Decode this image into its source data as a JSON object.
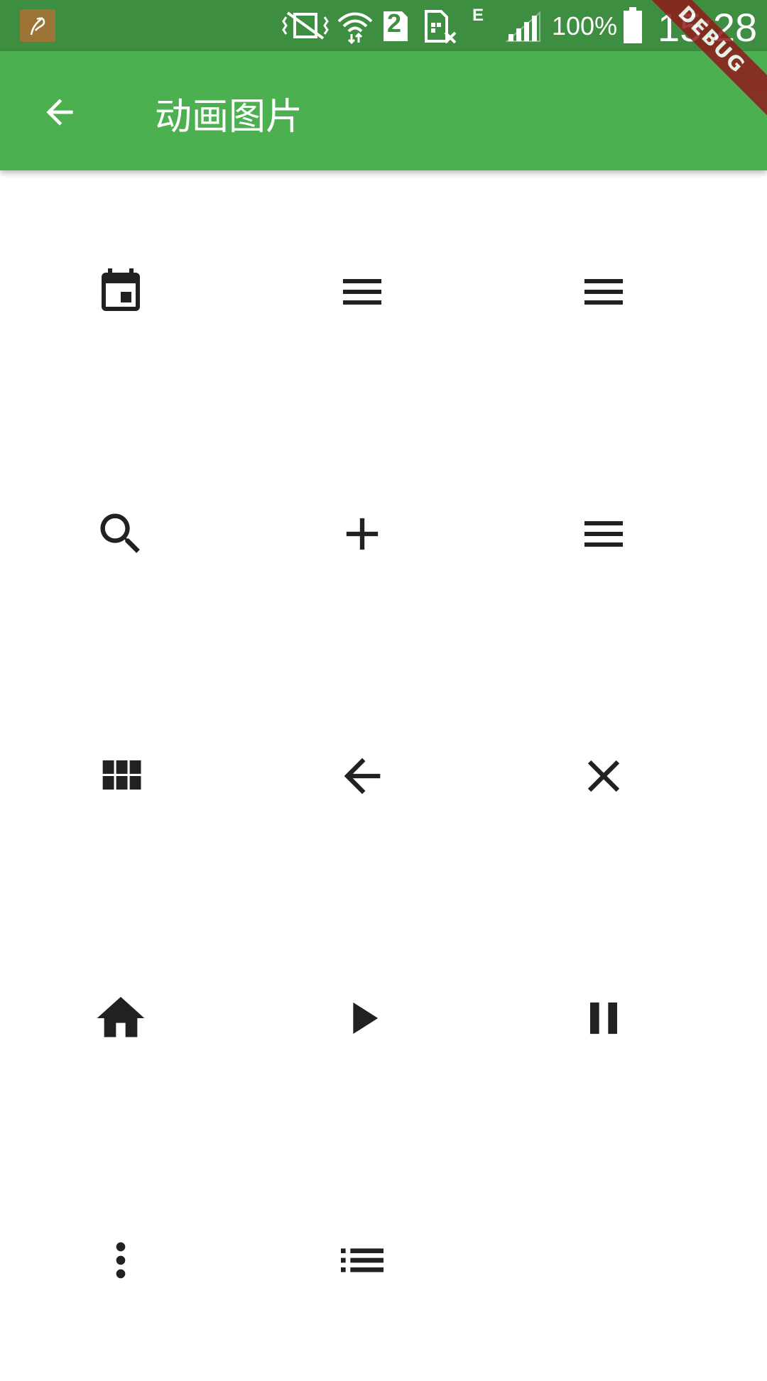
{
  "status_bar": {
    "network_type": "E",
    "sim_slot": "2",
    "battery_percent": "100%",
    "time": "15:28"
  },
  "debug_banner": "DEBUG",
  "app_bar": {
    "title": "动画图片",
    "back_icon": "arrow-back-icon",
    "background_color": "#4caf50"
  },
  "icons": [
    {
      "name": "calendar-icon"
    },
    {
      "name": "menu-icon"
    },
    {
      "name": "menu-icon"
    },
    {
      "name": "search-icon"
    },
    {
      "name": "add-icon"
    },
    {
      "name": "menu-icon"
    },
    {
      "name": "grid-view-icon"
    },
    {
      "name": "arrow-back-icon"
    },
    {
      "name": "close-icon"
    },
    {
      "name": "home-icon"
    },
    {
      "name": "play-icon"
    },
    {
      "name": "pause-icon"
    },
    {
      "name": "more-vert-icon"
    },
    {
      "name": "list-icon"
    }
  ],
  "colors": {
    "status_bar": "#3e8e41",
    "app_bar": "#4caf50",
    "icon": "#212121"
  }
}
